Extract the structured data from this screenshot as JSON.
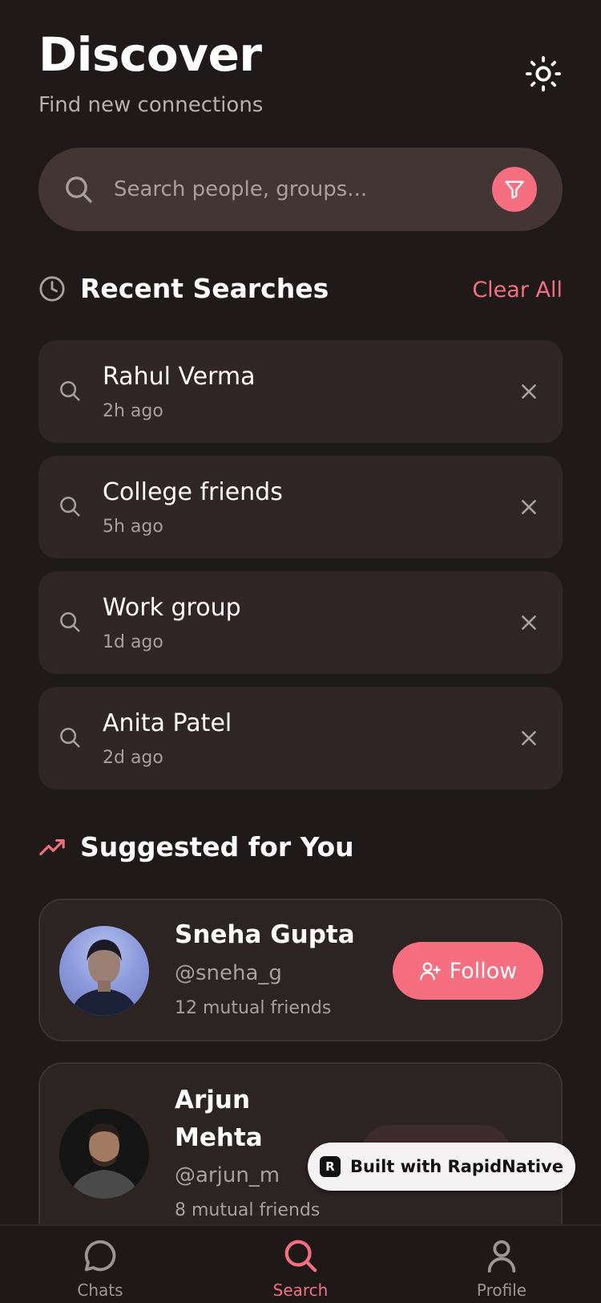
{
  "header": {
    "title": "Discover",
    "subtitle": "Find new connections",
    "theme_icon": "sun-icon"
  },
  "search": {
    "placeholder": "Search people, groups...",
    "value": "",
    "filter_icon": "filter-icon"
  },
  "recent": {
    "heading": "Recent Searches",
    "clear_label": "Clear All",
    "items": [
      {
        "name": "Rahul Verma",
        "time": "2h ago"
      },
      {
        "name": "College friends",
        "time": "5h ago"
      },
      {
        "name": "Work group",
        "time": "1d ago"
      },
      {
        "name": "Anita Patel",
        "time": "2d ago"
      }
    ]
  },
  "suggested": {
    "heading": "Suggested for You",
    "people": [
      {
        "name": "Sneha Gupta",
        "handle": "@sneha_g",
        "mutual": "12 mutual friends",
        "button": "Follow"
      },
      {
        "name_line1": "Arjun",
        "name_line2": "Mehta",
        "handle": "@arjun_m",
        "mutual": "8 mutual friends"
      }
    ]
  },
  "badge": {
    "logo": "R",
    "label": "Built with RapidNative"
  },
  "nav": {
    "items": [
      {
        "label": "Chats",
        "icon": "chat-bubble-icon"
      },
      {
        "label": "Search",
        "icon": "search-icon"
      },
      {
        "label": "Profile",
        "icon": "user-icon"
      }
    ],
    "active": "Search"
  },
  "colors": {
    "background": "#1f1a19",
    "accent": "#f56f81",
    "card": "#302626",
    "search_bar": "#443535"
  }
}
